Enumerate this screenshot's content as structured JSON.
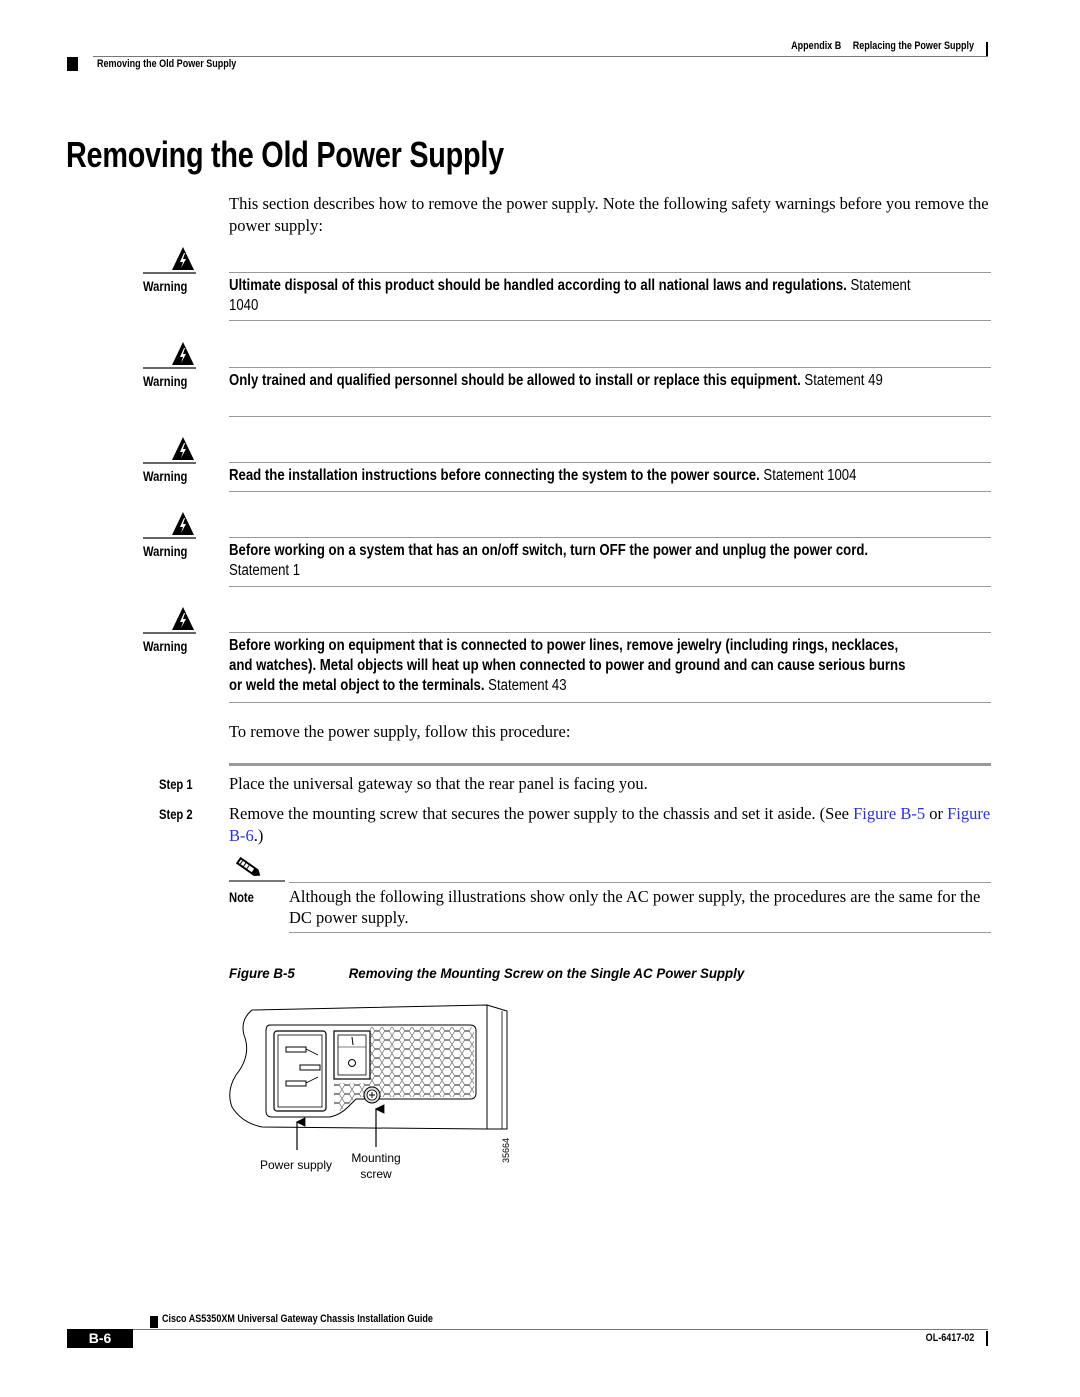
{
  "header": {
    "appendix": "Appendix B",
    "chapter": "Replacing the Power Supply",
    "section": "Removing the Old Power Supply"
  },
  "page_title": "Removing the Old Power Supply",
  "intro": "This section describes how to remove the power supply. Note the following safety warnings before you remove the power supply:",
  "warnings": [
    {
      "icon": "warning-triangle-icon",
      "label": "Warning",
      "bold": "Ultimate disposal of this product should be handled according to all national laws and regulations.",
      "statement": "Statement 1040"
    },
    {
      "icon": "warning-triangle-icon",
      "label": "Warning",
      "bold": "Only trained and qualified personnel should be allowed to install or replace this equipment.",
      "statement": "Statement 49"
    },
    {
      "icon": "warning-triangle-icon",
      "label": "Warning",
      "bold": "Read the installation instructions before connecting the system to the power source.",
      "statement": "Statement 1004"
    },
    {
      "icon": "warning-triangle-icon",
      "label": "Warning",
      "bold": "Before working on a system that has an on/off switch, turn OFF the power and unplug the power cord.",
      "statement": "Statement 1"
    },
    {
      "icon": "warning-triangle-icon",
      "label": "Warning",
      "bold": "Before working on equipment that is connected to power lines, remove jewelry (including rings, necklaces, and watches). Metal objects will heat up when connected to power and ground and can cause serious burns or weld the metal object to the terminals.",
      "statement": "Statement 43"
    }
  ],
  "procedure_intro": "To remove the power supply, follow this procedure:",
  "steps": [
    {
      "label": "Step 1",
      "text": "Place the universal gateway so that the rear panel is facing you."
    },
    {
      "label": "Step 2",
      "text_before": "Remove the mounting screw that secures the power supply to the chassis and set it aside. (See ",
      "link1": "Figure B-5",
      "text_mid": " or ",
      "link2": "Figure B-6",
      "text_after": ".)"
    }
  ],
  "note": {
    "icon": "pencil-note-icon",
    "label": "Note",
    "text": "Although the following illustrations show only the AC power supply, the procedures are the same for the DC power supply."
  },
  "figure": {
    "number": "Figure B-5",
    "caption": "Removing the Mounting Screw on the Single AC Power Supply",
    "callouts": {
      "power_supply": "Power supply",
      "mounting_line1": "Mounting",
      "mounting_line2": "screw"
    },
    "art_id": "35664"
  },
  "footer": {
    "guide_title": "Cisco AS5350XM Universal Gateway Chassis Installation Guide",
    "page_number": "B-6",
    "doc_number": "OL-6417-02"
  },
  "colors": {
    "link": "#2a33d6",
    "rule": "#999999"
  }
}
